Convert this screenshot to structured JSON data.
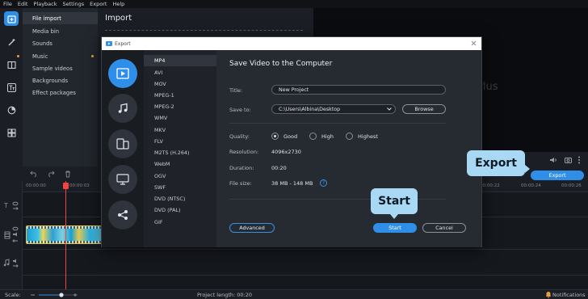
{
  "menu": [
    "File",
    "Edit",
    "Playback",
    "Settings",
    "Export",
    "Help"
  ],
  "side_menu": [
    "File import",
    "Media bin",
    "Sounds",
    "Music",
    "Sample videos",
    "Backgrounds",
    "Effect packages"
  ],
  "import_title": "Import",
  "preview_text": [
    "i",
    "Plus"
  ],
  "timeline": {
    "ticks": [
      "00:00:00",
      "00:00:03",
      "00:00:22",
      "00:00:24",
      "00:00:26"
    ],
    "export_button": "Export"
  },
  "dialog": {
    "title": "Export",
    "heading": "Save Video to the Computer",
    "formats": [
      "MP4",
      "AVI",
      "MOV",
      "MPEG-1",
      "MPEG-2",
      "WMV",
      "MKV",
      "FLV",
      "M2TS (H.264)",
      "WebM",
      "OGV",
      "SWF",
      "DVD (NTSC)",
      "DVD (PAL)",
      "GIF"
    ],
    "selected_format": "MP4",
    "title_label": "Title:",
    "title_value": "New Project",
    "save_to_label": "Save to:",
    "save_to_value": "C:\\Users\\Albina\\Desktop",
    "browse": "Browse",
    "quality_label": "Quality:",
    "quality_options": [
      "Good",
      "High",
      "Highest"
    ],
    "quality_selected": "Good",
    "resolution_label": "Resolution:",
    "resolution_value": "4096x2730",
    "duration_label": "Duration:",
    "duration_value": "00:20",
    "filesize_label": "File size:",
    "filesize_value": "38 MB - 148 MB",
    "help_glyph": "?",
    "advanced": "Advanced",
    "start": "Start",
    "cancel": "Cancel"
  },
  "callouts": {
    "start": "Start",
    "export": "Export"
  },
  "status": {
    "scale_label": "Scale:",
    "project_length": "Project length: 00:20",
    "notifications": "Notifications"
  },
  "colors": {
    "accent": "#2f8fe8",
    "callout": "#a9d8f5",
    "playhead": "#e44444",
    "clip_border": "#e8c34a"
  }
}
